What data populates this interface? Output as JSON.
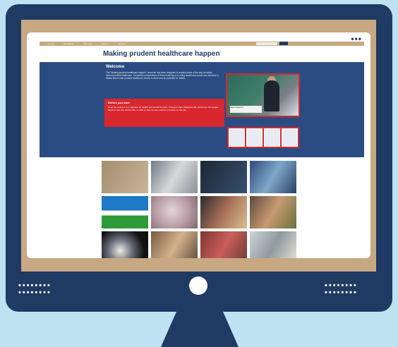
{
  "screen": {
    "window_menu_dots": "•••",
    "nav_items": [
      "Home",
      "Navigation",
      "Planning",
      "Search",
      "Support"
    ],
    "site_title": "Making prudent healthcare happen",
    "welcome": {
      "heading": "Welcome",
      "body": "The \"Making prudent healthcare happen\" resource has been designed to explain some of the key concepts behind prudent healthcare. It explores perspectives of those working in or using health and social care services in Wales about what prudent healthcare means to them and its potential for Wales."
    },
    "before_you_start": {
      "heading": "Before you start",
      "body": "Read the welcome from Minister for Health and Social Services, Professor Mark Drakeford AM. Scroll over the images below to view the section title, or click on them to see a full list of articles on this site."
    },
    "video_caption": "Mark Drakeford",
    "bezel_dots_left": "••••••••",
    "bezel_dots_right": "••••••••"
  }
}
